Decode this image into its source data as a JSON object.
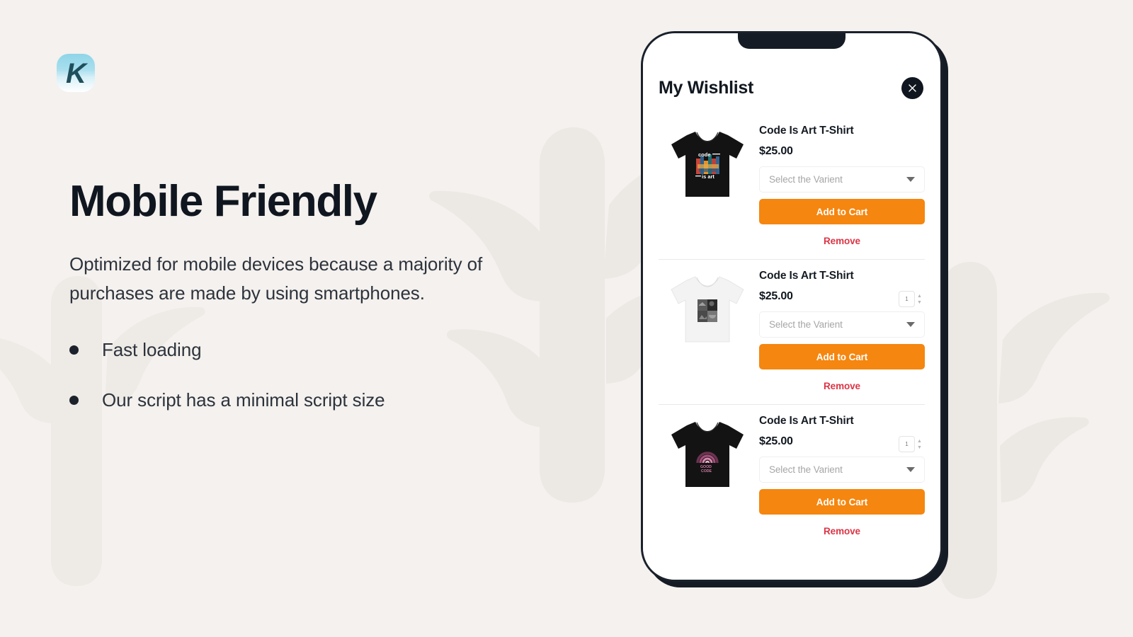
{
  "brand": {
    "logo_letter": "K",
    "logo_icon": "k-logo-icon",
    "logo_gradient_top": "#8ed5e8",
    "logo_letter_color": "#1f4f5b"
  },
  "background": {
    "page_color": "#f4f1ee",
    "watermark_color": "#ece8e4",
    "watermark_icon": "cactus-silhouette-icon"
  },
  "marketing": {
    "headline": "Mobile Friendly",
    "paragraph": "Optimized for mobile devices because a majority of purchases are made by using smartphones.",
    "bullets": [
      {
        "label": "Fast loading"
      },
      {
        "label": "Our script has a minimal script size"
      }
    ]
  },
  "phone": {
    "wishlist": {
      "title": "My Wishlist",
      "close_icon": "close-x-icon",
      "items": [
        {
          "name": "Code Is Art T-Shirt",
          "price": "$25.00",
          "variant_placeholder": "Select the Varient",
          "add_label": "Add to Cart",
          "remove_label": "Remove",
          "quantity": "",
          "has_quantity": false,
          "thumb_icon": "tshirt-black-code-is-art-icon",
          "shirt_color": "#131313"
        },
        {
          "name": "Code Is Art T-Shirt",
          "price": "$25.00",
          "variant_placeholder": "Select the Varient",
          "add_label": "Add to Cart",
          "remove_label": "Remove",
          "quantity": "1",
          "has_quantity": true,
          "thumb_icon": "tshirt-white-photo-grid-icon",
          "shirt_color": "#f3f3f3"
        },
        {
          "name": "Code Is Art T-Shirt",
          "price": "$25.00",
          "variant_placeholder": "Select the Varient",
          "add_label": "Add to Cart",
          "remove_label": "Remove",
          "quantity": "1",
          "has_quantity": true,
          "thumb_icon": "tshirt-black-rainbow-good-code-icon",
          "shirt_color": "#131313"
        }
      ]
    },
    "colors": {
      "accent_orange": "#f5860f",
      "remove_red": "#dc3545",
      "frame_dark": "#141b24"
    }
  }
}
